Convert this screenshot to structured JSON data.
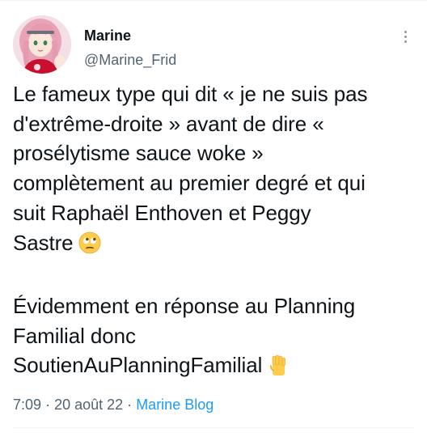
{
  "author": {
    "display_name": "Marine",
    "handle": "@Marine_Frid",
    "avatar_icon": "anime-avatar"
  },
  "tweet": {
    "lines": [
      "Le fameux type qui dit « je ne suis pas",
      "d'extrême-droite » avant de dire «",
      "prosélytisme sauce woke »",
      "complètement au premier degré et qui",
      "suit Raphaël Enthoven et Peggy",
      "Sastre",
      "Évidemment en réponse au Planning",
      "Familial donc",
      "SoutienAuPlanningFamilial"
    ],
    "emoji_1": "face-with-rolling-eyes-icon",
    "emoji_2": "raised-fist-icon"
  },
  "meta": {
    "time": "7:09",
    "separator": "·",
    "date": "20 août 22",
    "source": "Marine Blog"
  },
  "colors": {
    "text": "#0f1419",
    "secondary": "#536471",
    "link": "#1d9bf0"
  }
}
